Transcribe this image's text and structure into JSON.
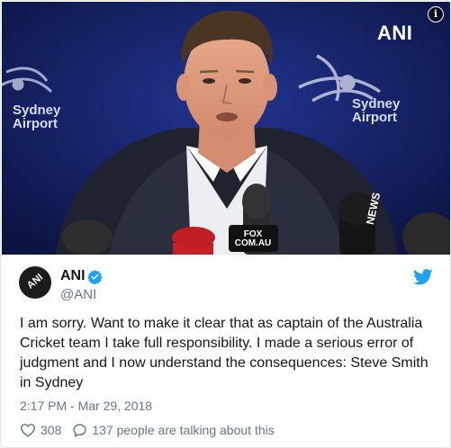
{
  "media": {
    "watermark": "ANI",
    "info_glyph": "i",
    "left_sign": {
      "line1": "Sydney",
      "line2": "Airport"
    },
    "right_sign": {
      "line1": "Sydney",
      "line2": "Airport"
    },
    "mic_fox": "FOX\nCOM.AU",
    "mic_news": "NEWS"
  },
  "author": {
    "avatar_text": "ANI",
    "name": "ANI",
    "handle": "@ANI",
    "verified": true
  },
  "tweet": {
    "text": "I am sorry. Want to make it clear that as captain of the Australia Cricket team I take full responsibility. I made a serious error of judgment and I now understand the consequences: Steve Smith in Sydney",
    "timestamp": "2:17 PM - Mar 29, 2018"
  },
  "stats": {
    "likes": "308",
    "talking": "137 people are talking about this"
  },
  "colors": {
    "twitter_blue": "#1da1f2",
    "secondary_text": "#657786",
    "primary_text": "#14171a"
  },
  "icons": [
    "info-icon",
    "verified-icon",
    "twitter-bird-icon",
    "heart-icon",
    "speech-bubble-icon"
  ]
}
